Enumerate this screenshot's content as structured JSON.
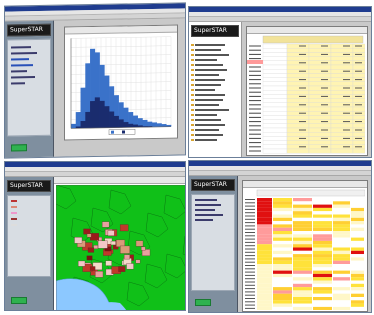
{
  "app": {
    "logo_text": "SuperSTAR",
    "colors": {
      "titlebar": "#1f3c8f",
      "sidebar": "#7f8f9f",
      "chart_blue": "#2f62b3",
      "map_green": "#10c018",
      "map_red": "#9b1b1b",
      "heat_red": "#e01010",
      "heat_yellow": "#ffe23a"
    }
  },
  "windows": [
    {
      "name": "histogram-window",
      "content": "histogram"
    },
    {
      "name": "table-window",
      "content": "crosstab-table"
    },
    {
      "name": "map-window",
      "content": "thematic-map"
    },
    {
      "name": "heatmap-window",
      "content": "colored-table"
    }
  ],
  "chart_data": {
    "type": "area",
    "x": [
      0,
      1,
      2,
      3,
      4,
      5,
      6,
      7,
      8,
      9,
      10,
      11,
      12,
      13,
      14,
      15,
      16,
      17,
      18,
      19,
      20
    ],
    "series": [
      {
        "values": [
          5,
          18,
          45,
          72,
          88,
          84,
          70,
          58,
          46,
          36,
          28,
          22,
          17,
          13,
          10,
          8,
          6,
          5,
          4,
          3,
          2
        ]
      },
      {
        "values": [
          0,
          2,
          8,
          18,
          30,
          34,
          30,
          24,
          18,
          13,
          9,
          6,
          4,
          3,
          2,
          1,
          1,
          0,
          0,
          0,
          0
        ]
      }
    ]
  }
}
